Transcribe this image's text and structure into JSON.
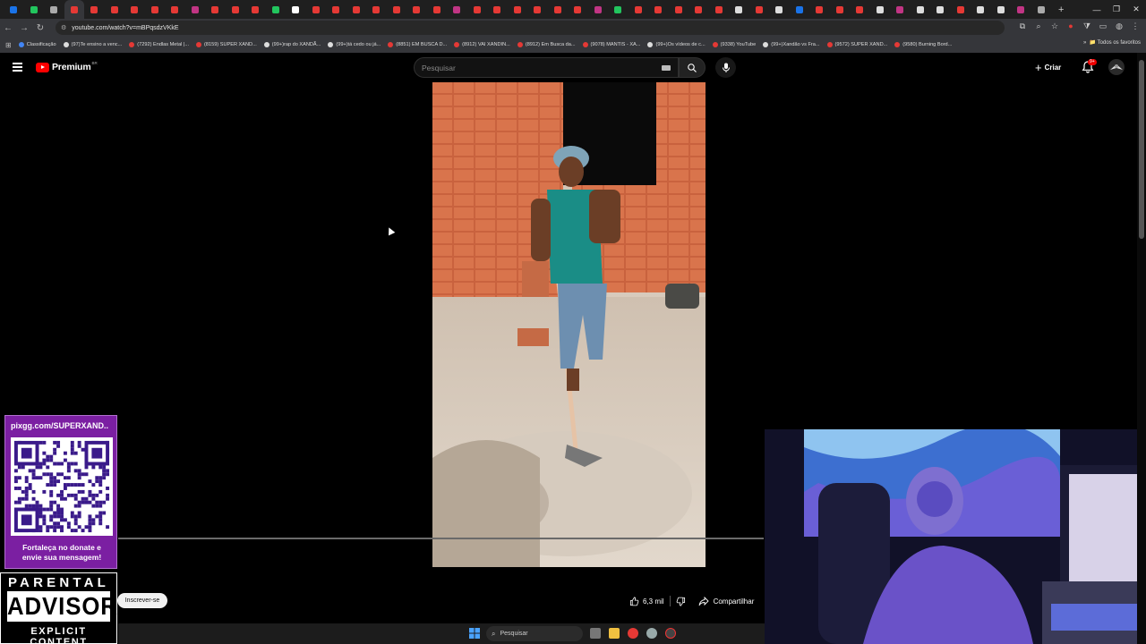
{
  "browser": {
    "url": "youtube.com/watch?v=mBPqsdzVKkE",
    "tab_colors": [
      "#1a73e8",
      "#22c55e",
      "#aaaaaa",
      "#e53935",
      "#e53935",
      "#e53935",
      "#e53935",
      "#e53935",
      "#e53935",
      "#c13584",
      "#e53935",
      "#e53935",
      "#e53935",
      "#22c55e",
      "#ffffff",
      "#e53935",
      "#e53935",
      "#e53935",
      "#e53935",
      "#e53935",
      "#e53935",
      "#e53935",
      "#c13584",
      "#e53935",
      "#e53935",
      "#e53935",
      "#e53935",
      "#e53935",
      "#e53935",
      "#c13584",
      "#22c55e",
      "#e53935",
      "#e53935",
      "#e53935",
      "#e53935",
      "#e53935",
      "#dddddd",
      "#e53935",
      "#dddddd",
      "#1a73e8",
      "#e53935",
      "#e53935",
      "#e53935",
      "#dddddd",
      "#c13584",
      "#dddddd",
      "#dddddd",
      "#e53935",
      "#dddddd",
      "#dddddd",
      "#c13584",
      "#aaaaaa"
    ],
    "new_tab": "+",
    "bookmarks": [
      {
        "label": "Classificação",
        "color": "#4285f4"
      },
      {
        "label": "(97)Te ensino a venc...",
        "color": "#dddddd"
      },
      {
        "label": "(7292) Endlas Metal |...",
        "color": "#e53935"
      },
      {
        "label": "(8159) SUPER XAND...",
        "color": "#e53935"
      },
      {
        "label": "(99+)rap do XANDÃ...",
        "color": "#dddddd"
      },
      {
        "label": "(99+)tá cedo ou já...",
        "color": "#dddddd"
      },
      {
        "label": "(8851) EM BUSCA D...",
        "color": "#e53935"
      },
      {
        "label": "(8912) VAI XANDIN...",
        "color": "#e53935"
      },
      {
        "label": "(8912) Em Busca da...",
        "color": "#e53935"
      },
      {
        "label": "(9078) MANTIS - XA...",
        "color": "#e53935"
      },
      {
        "label": "(99+)Os vídeos de c...",
        "color": "#dddddd"
      },
      {
        "label": "(9338) YouTube",
        "color": "#e53935"
      },
      {
        "label": "(99+)Xandão vs Fra...",
        "color": "#dddddd"
      },
      {
        "label": "(9572) SUPER XAND...",
        "color": "#e53935"
      },
      {
        "label": "(9580) Burning Bord...",
        "color": "#e53935"
      }
    ],
    "all_bookmarks": "Todos os favoritos"
  },
  "youtube": {
    "logo_text": "Premium",
    "logo_region": "BR",
    "search_placeholder": "Pesquisar",
    "create_label": "Criar",
    "notifications_badge": "9+",
    "subscribe_label": "Inscrever-se",
    "like_count": "6,3 mil",
    "share_label": "Compartilhar"
  },
  "overlay": {
    "pix_url": "pixgg.com/SUPERXAND..",
    "pix_message_line1": "Fortaleça no donate e",
    "pix_message_line2": "envie sua mensagem!",
    "advisory_top": "PARENTAL",
    "advisory_mid": "ADVISORY",
    "advisory_bottom": "EXPLICIT CONTENT"
  },
  "taskbar": {
    "search_label": "Pesquisar"
  }
}
